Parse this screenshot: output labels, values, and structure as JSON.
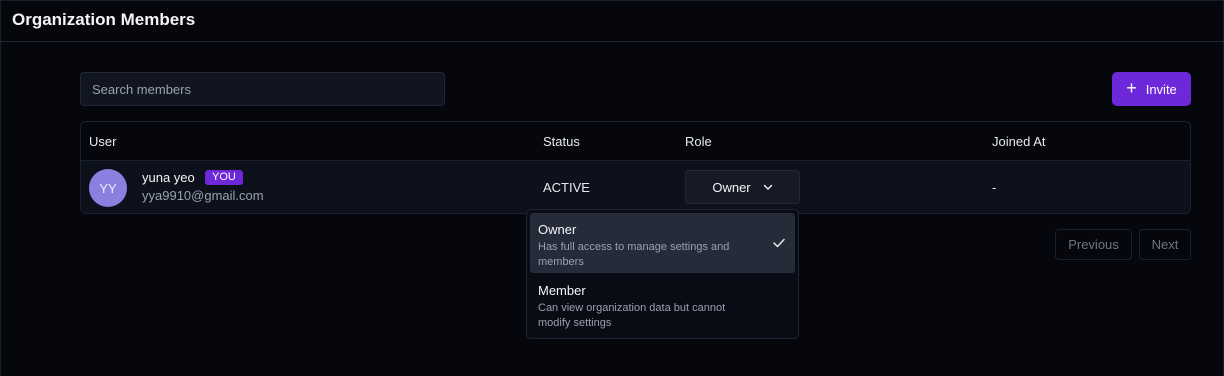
{
  "header": {
    "title": "Organization Members"
  },
  "toolbar": {
    "search_placeholder": "Search members",
    "invite_label": "Invite",
    "invite_icon": "plus-icon"
  },
  "table": {
    "columns": [
      "User",
      "Status",
      "Role",
      "Joined At"
    ],
    "rows": [
      {
        "initials": "YY",
        "name": "yuna yeo",
        "badge": "YOU",
        "email": "yya9910@gmail.com",
        "status": "ACTIVE",
        "role": "Owner",
        "joined": "-"
      }
    ]
  },
  "role_dropdown": {
    "options": [
      {
        "title": "Owner",
        "description": "Has full access to manage settings and members",
        "selected": true
      },
      {
        "title": "Member",
        "description": "Can view organization data but cannot modify settings",
        "selected": false
      }
    ]
  },
  "pagination": {
    "previous_label": "Previous",
    "next_label": "Next"
  },
  "colors": {
    "accent": "#6d28d9",
    "avatar": "#8b80e0",
    "background": "#05070d"
  }
}
